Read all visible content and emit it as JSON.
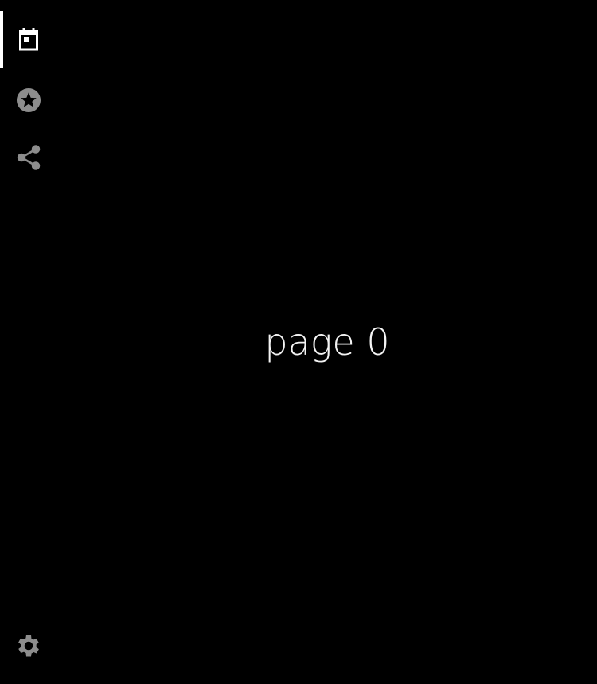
{
  "nav": {
    "items": [
      {
        "icon": "calendar-icon",
        "active": true
      },
      {
        "icon": "star-circle-icon",
        "active": false
      },
      {
        "icon": "share-icon",
        "active": false
      }
    ],
    "settings": {
      "icon": "gear-icon"
    }
  },
  "colors": {
    "background": "#000000",
    "active_icon": "#ffffff",
    "inactive_icon": "#8d8d8d",
    "indicator": "#ffffff"
  },
  "main": {
    "label": "page 0"
  }
}
